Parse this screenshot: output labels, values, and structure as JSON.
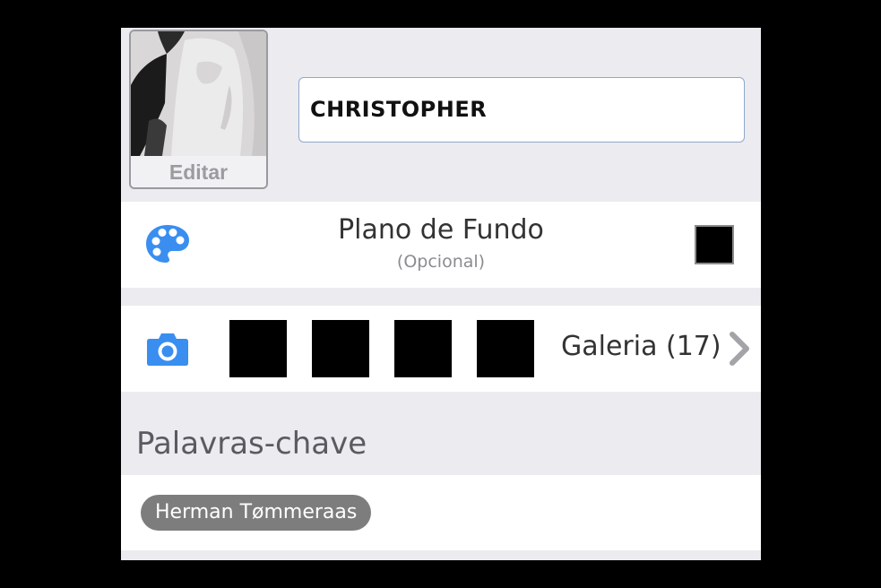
{
  "profile": {
    "edit_label": "Editar",
    "name_value": "CHRISTOPHER"
  },
  "background": {
    "title": "Plano de Fundo",
    "subtitle": "(Opcional)",
    "icon": "palette-icon",
    "swatch_color": "#000000"
  },
  "gallery": {
    "icon": "camera-icon",
    "thumbnails": [
      "#000000",
      "#000000",
      "#000000",
      "#000000"
    ],
    "label": "Galeria (17)"
  },
  "keywords": {
    "header": "Palavras-chave",
    "chips": [
      "Herman Tømmeraas"
    ]
  },
  "colors": {
    "accent": "#3a8ef0",
    "chip": "#7d7d7d",
    "panel": "#ebebf0"
  }
}
